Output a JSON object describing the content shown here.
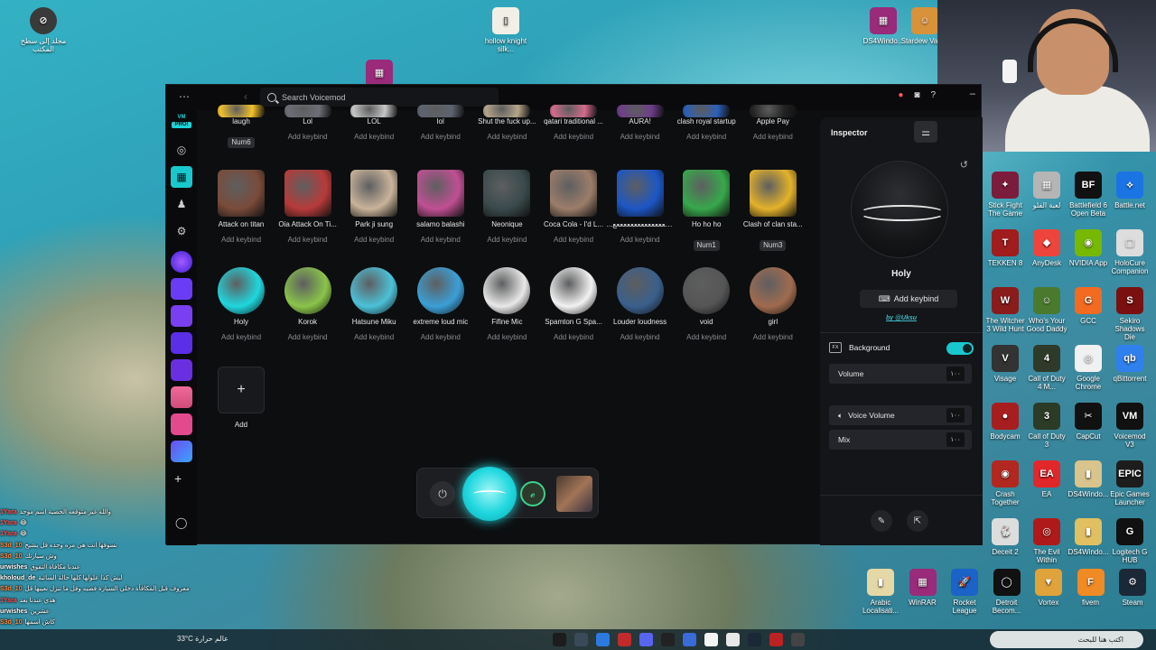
{
  "app": {
    "search_placeholder": "Search Voicemod",
    "logo_text": "VM",
    "logo_badge": "PRO!"
  },
  "grid": {
    "row1": [
      {
        "name": "laugh",
        "keybind": "Num6",
        "set": true,
        "color": "#f3c12b"
      },
      {
        "name": "Lol",
        "keybind": "Add keybind",
        "set": false,
        "color": "#6c6f77"
      },
      {
        "name": "LOL",
        "keybind": "Add keybind",
        "set": false,
        "color": "#c6c6c6"
      },
      {
        "name": "lol",
        "keybind": "Add keybind",
        "set": false,
        "color": "#5d6370"
      },
      {
        "name": "Shut the fuck up...",
        "keybind": "Add keybind",
        "set": false,
        "color": "#b6a68a"
      },
      {
        "name": "qatari traditional ...",
        "keybind": "Add keybind",
        "set": false,
        "color": "#d46b8c"
      },
      {
        "name": "AURA!",
        "keybind": "Add keybind",
        "set": false,
        "color": "#6e3d8a"
      },
      {
        "name": "clash royal startup",
        "keybind": "Add keybind",
        "set": false,
        "color": "#2c5fb8"
      },
      {
        "name": "Apple Pay",
        "keybind": "Add keybind",
        "set": false,
        "color": "#222"
      }
    ],
    "row2": [
      {
        "name": "Attack on titan",
        "keybind": "Add keybind",
        "set": false,
        "color": "#7a4b3a"
      },
      {
        "name": "Oia Attack On Ti...",
        "keybind": "Add keybind",
        "set": false,
        "color": "#b83a3a"
      },
      {
        "name": "Park ji sung",
        "keybind": "Add keybind",
        "set": false,
        "color": "#c9b39a"
      },
      {
        "name": "salamo balashi",
        "keybind": "Add keybind",
        "set": false,
        "color": "#c04f93"
      },
      {
        "name": "Neonique",
        "keybind": "Add keybind",
        "set": false,
        "color": "#3a4a4c"
      },
      {
        "name": "Coca Cola - I'd L...",
        "keybind": "Add keybind",
        "set": false,
        "color": "#9c7d6a"
      },
      {
        "name": "...عععععععععععععععععععععع",
        "keybind": "Add keybind",
        "set": false,
        "color": "#1c56c6"
      },
      {
        "name": "Ho ho ho",
        "keybind": "Num1",
        "set": true,
        "color": "#37a84b"
      },
      {
        "name": "Clash of clan sta...",
        "keybind": "Num3",
        "set": true,
        "color": "#e4b22a"
      }
    ],
    "row3": [
      {
        "name": "Holy",
        "keybind": "Add keybind",
        "set": false,
        "color": "#1fd7de"
      },
      {
        "name": "Korok",
        "keybind": "Add keybind",
        "set": false,
        "color": "#8ac44a"
      },
      {
        "name": "Hatsune Miku",
        "keybind": "Add keybind",
        "set": false,
        "color": "#4cc1d8"
      },
      {
        "name": "extreme loud mic",
        "keybind": "Add keybind",
        "set": false,
        "color": "#3b9fd6"
      },
      {
        "name": "Fifine Mic",
        "keybind": "Add keybind",
        "set": false,
        "color": "#e8e8e8"
      },
      {
        "name": "Spamton G Spa...",
        "keybind": "Add keybind",
        "set": false,
        "color": "#f2f2f2"
      },
      {
        "name": "Louder loudness",
        "keybind": "Add keybind",
        "set": false,
        "color": "#3a5f8c"
      },
      {
        "name": "void",
        "keybind": "Add keybind",
        "set": false,
        "color": "#555"
      },
      {
        "name": "girl",
        "keybind": "Add keybind",
        "set": false,
        "color": "#a06b4f"
      }
    ],
    "add_label": "Add"
  },
  "inspector": {
    "title": "Inspector",
    "sound_name": "Holy",
    "add_keybind": "Add keybind",
    "author": "by @Uksu",
    "background_label": "Background",
    "fx_badge": "FX",
    "volume_label": "Volume",
    "volume_value": "١٠٠",
    "voice_volume_label": "Voice Volume",
    "voice_volume_value": "١٠٠",
    "mix_label": "Mix",
    "mix_value": "١٠٠"
  },
  "chat": [
    {
      "user": "1Yara",
      "text": "والله غير متوقعه الحصية اسم موحد",
      "color": "#ff5050"
    },
    {
      "user": "1Yara",
      "text": "😂",
      "color": "#ff5050"
    },
    {
      "user": "1Yara",
      "text": "😂",
      "color": "#ff5050"
    },
    {
      "user": "S3d_10",
      "text": "تسوقها انت هي مره وحده قل يشيخ",
      "color": "#ff8a3d"
    },
    {
      "user": "S3d_10",
      "text": "وش سيارتك",
      "color": "#ff8a3d"
    },
    {
      "user": "urwishes",
      "text": "عندنا مكافاة التفوق",
      "color": "#ffffff"
    },
    {
      "user": "kholoud_de",
      "text": "ليش كذا علولها كلها حالة السائبة",
      "color": "#ffffff"
    },
    {
      "user": "S3d_10",
      "text": "معروف قبل المكافأة دخلي السيارة فضيه وقل ما تنزل نعيبها قل",
      "color": "#ff8a3d"
    },
    {
      "user": "1Yara",
      "text": "هذي عندنا بعد",
      "color": "#ff5050"
    },
    {
      "user": "urwishes",
      "text": "عشرين",
      "color": "#ffffff"
    },
    {
      "user": "S3d_10",
      "text": "كاش اسمها",
      "color": "#ff8a3d"
    }
  ],
  "desktop": {
    "top_left": "مجلد إلى سطح المكتب",
    "hollow": "hollow knight silk...",
    "ds4": "DS4Windo...",
    "stardew": "Stardew Valley",
    "right_col": [
      {
        "label": "Stick Fight The Game",
        "color": "#7c1c3c",
        "glyph": "✦"
      },
      {
        "label": "لعبة الفلو",
        "color": "#b5b5b5",
        "glyph": "▦"
      },
      {
        "label": "Battlefield 6 Open Beta",
        "color": "#111",
        "glyph": "BF"
      },
      {
        "label": "Battle.net",
        "color": "#1b74e4",
        "glyph": "⟡"
      },
      {
        "label": "TEKKEN 8",
        "color": "#a11c1c",
        "glyph": "T"
      },
      {
        "label": "AnyDesk",
        "color": "#ef443b",
        "glyph": "◆"
      },
      {
        "label": "NVIDIA App",
        "color": "#76b900",
        "glyph": "◉"
      },
      {
        "label": "HoloCure Companion",
        "color": "#ddd",
        "glyph": "▢"
      },
      {
        "label": "The Witcher 3 Wild Hunt",
        "color": "#8a1c1c",
        "glyph": "W"
      },
      {
        "label": "Who's Your Good Daddy",
        "color": "#4a7a2e",
        "glyph": "☺"
      },
      {
        "label": "GCC",
        "color": "#f26b21",
        "glyph": "G"
      },
      {
        "label": "Sekiro Shadows Die",
        "color": "#7a1010",
        "glyph": "S"
      },
      {
        "label": "Visage",
        "color": "#333",
        "glyph": "V"
      },
      {
        "label": "Call of Duty 4 M...",
        "color": "#2e3b2a",
        "glyph": "4"
      },
      {
        "label": "Google Chrome",
        "color": "#f1f1f1",
        "glyph": "◎"
      },
      {
        "label": "qBittorrent",
        "color": "#2f80ed",
        "glyph": "qb"
      },
      {
        "label": "Bodycam",
        "color": "#a71e1e",
        "glyph": "●"
      },
      {
        "label": "Call of Duty 3",
        "color": "#2c3b26",
        "glyph": "3"
      },
      {
        "label": "CapCut",
        "color": "#111",
        "glyph": "✂"
      },
      {
        "label": "Voicemod V3",
        "color": "#111",
        "glyph": "VM"
      },
      {
        "label": "Crash Together",
        "color": "#b2271f",
        "glyph": "◉"
      },
      {
        "label": "EA",
        "color": "#e2272a",
        "glyph": "EA"
      },
      {
        "label": "DS4Windo...",
        "color": "#d8c48c",
        "glyph": "▮"
      },
      {
        "label": "Epic Games Launcher",
        "color": "#1d1d1d",
        "glyph": "EPIC"
      },
      {
        "label": "Deceit 2",
        "color": "#ddd",
        "glyph": "🐇"
      },
      {
        "label": "The Evil Within",
        "color": "#b01919",
        "glyph": "◎"
      },
      {
        "label": "DS4Windo...",
        "color": "#e0c060",
        "glyph": "▮"
      },
      {
        "label": "Logitech G HUB",
        "color": "#111",
        "glyph": "G"
      }
    ],
    "bottom_row": [
      {
        "label": "Arabic Localisati...",
        "color": "#e6d8a6",
        "glyph": "▮"
      },
      {
        "label": "WinRAR",
        "color": "#9a2a7a",
        "glyph": "▦"
      },
      {
        "label": "Rocket League",
        "color": "#1b63c6",
        "glyph": "🚀"
      },
      {
        "label": "Detroit Becom...",
        "color": "#111",
        "glyph": "◯"
      },
      {
        "label": "Vortex",
        "color": "#e0a23a",
        "glyph": "▼"
      },
      {
        "label": "fivem",
        "color": "#f08a24",
        "glyph": "F"
      },
      {
        "label": "Steam",
        "color": "#1b2838",
        "glyph": "⚙"
      }
    ]
  },
  "taskbar": {
    "search_placeholder": "اكتب هنا للبحث",
    "weather": "33°C عالم حرارة"
  }
}
